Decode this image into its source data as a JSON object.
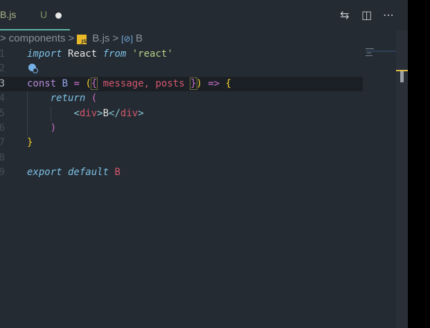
{
  "tab": {
    "name": "B.js",
    "status": "U"
  },
  "actions": {
    "compare": "⇆",
    "split": "◫",
    "more": "⋯"
  },
  "breadcrumb": {
    "sep": ">",
    "folder": "components",
    "js_badge": "JS",
    "file": "B.js",
    "symbol_icon": "[⊘]",
    "symbol": "B"
  },
  "lines": [
    {
      "n": "1"
    },
    {
      "n": "2"
    },
    {
      "n": "3"
    },
    {
      "n": "4"
    },
    {
      "n": "5"
    },
    {
      "n": "6"
    },
    {
      "n": "7"
    },
    {
      "n": "8"
    },
    {
      "n": "9"
    }
  ],
  "code": {
    "l1": {
      "import": "import",
      "react": " React ",
      "from": "from",
      "str": " 'react'"
    },
    "l3": {
      "const": "const",
      "name": "B",
      "eq": " = ",
      "p1": "(",
      "b1": "{",
      "params": " message, posts ",
      "b2": "}",
      "p2": ")",
      "arrow": " => ",
      "b3": "{"
    },
    "l4": {
      "ret": "return",
      "p": "("
    },
    "l5": {
      "lt": "<",
      "tag1": "div",
      "gt": ">",
      "text": "B",
      "lt2": "</",
      "tag2": "div",
      "gt2": ">"
    },
    "l6": {
      "p": ")"
    },
    "l7": {
      "b": "}"
    },
    "l9": {
      "exp": "export default",
      "name": "B"
    }
  },
  "colors": {
    "background": "#252b32",
    "tab_underline": "#5fb3a8"
  }
}
